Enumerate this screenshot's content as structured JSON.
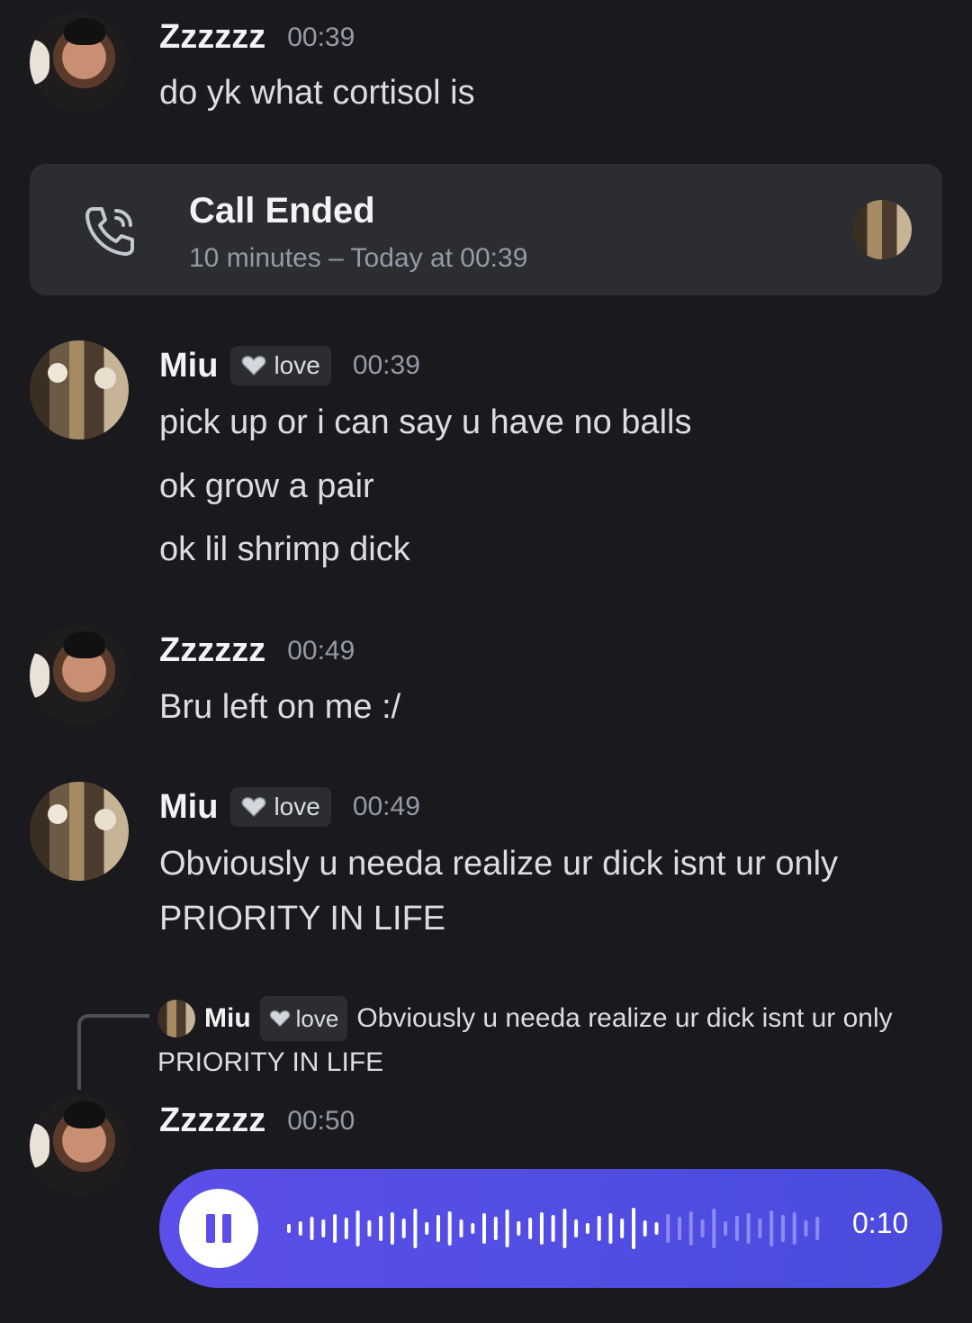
{
  "messages": [
    {
      "user": "Zzzzzz",
      "time": "00:39",
      "lines": [
        "do yk what cortisol is"
      ]
    },
    {
      "user": "Miu",
      "tag": "love",
      "time": "00:39",
      "lines": [
        "pick up or i can say u have no balls",
        "ok grow a pair",
        "ok lil shrimp dick"
      ]
    },
    {
      "user": "Zzzzzz",
      "time": "00:49",
      "lines": [
        "Bru left on me :/"
      ]
    },
    {
      "user": "Miu",
      "tag": "love",
      "time": "00:49",
      "lines": [
        "Obviously u needa realize ur dick isnt ur only",
        "PRIORITY IN LIFE"
      ]
    },
    {
      "user": "Zzzzzz",
      "time": "00:50"
    }
  ],
  "call": {
    "title": "Call Ended",
    "subtitle": "10 minutes – Today at 00:39"
  },
  "reply": {
    "user": "Miu",
    "tag": "love",
    "text": "Obviously u needa realize ur dick isnt ur only PRIORITY IN LIFE"
  },
  "voice": {
    "duration": "0:10",
    "progress": 0.7
  },
  "colors": {
    "background": "#1a1a1e",
    "card": "#2b2d31",
    "voice_accent": "#5a4fe8",
    "muted": "#949ba4"
  },
  "icons": {
    "call": "phone-icon",
    "tag": "heart-icon",
    "voice": "pause-icon"
  }
}
